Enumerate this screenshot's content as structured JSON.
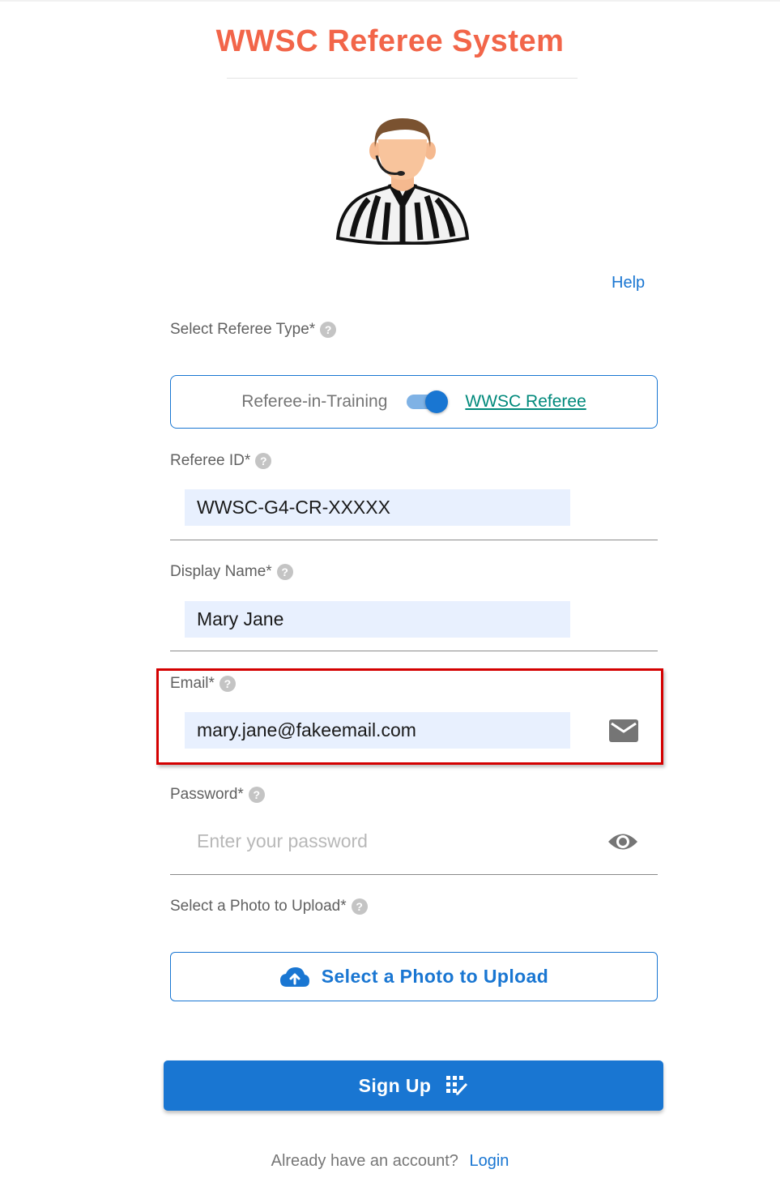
{
  "app": {
    "title": "WWSC Referee System",
    "help_label": "Help"
  },
  "colors": {
    "title": "#f26549",
    "primary": "#1976d2",
    "link_teal": "#00897b",
    "input_fill": "#e8f0fe",
    "highlight_border": "#d40000"
  },
  "form": {
    "referee_type": {
      "label": "Select Referee Type*",
      "option_left": "Referee-in-Training",
      "option_right": "WWSC Referee",
      "selected": "WWSC Referee"
    },
    "referee_id": {
      "label": "Referee ID*",
      "value": "WWSC-G4-CR-XXXXX"
    },
    "display_name": {
      "label": "Display Name*",
      "value": "Mary Jane"
    },
    "email": {
      "label": "Email*",
      "value": "mary.jane@fakeemail.com",
      "icon": "mail-icon"
    },
    "password": {
      "label": "Password*",
      "placeholder": "Enter your password",
      "icon": "eye-icon"
    },
    "photo": {
      "label": "Select a Photo to Upload*",
      "button_label": "Select a Photo to Upload",
      "icon": "cloud-upload-icon"
    },
    "submit": {
      "label": "Sign Up",
      "icon": "signup-icon"
    }
  },
  "footer": {
    "prompt": "Already have an account?",
    "link_label": "Login"
  }
}
